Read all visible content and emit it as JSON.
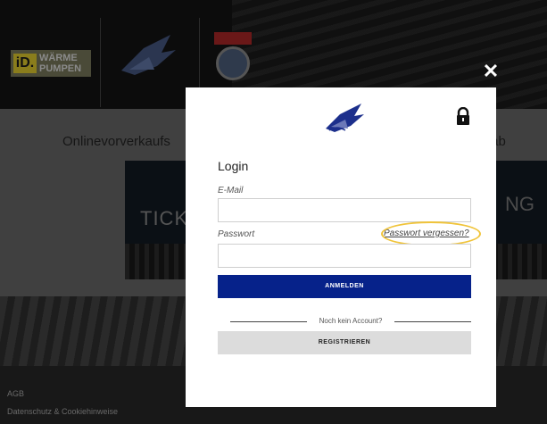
{
  "background": {
    "sponsor_logo": {
      "badge": "iD.",
      "line1": "WÄRME",
      "line2": "PUMPEN"
    },
    "heading_left": "Onlinevorverkaufs",
    "heading_right": "nts ab",
    "banner_left": "TICK",
    "banner_right": "NG",
    "footer": {
      "agb": "AGB",
      "privacy": "Datenschutz & Cookiehinweise"
    }
  },
  "overlay": {
    "close_icon": "close-icon"
  },
  "login": {
    "title": "Login",
    "email_label": "E-Mail",
    "email_value": "",
    "password_label": "Passwort",
    "password_value": "",
    "forgot_link": "Passwort vergessen?",
    "login_button": "ANMELDEN",
    "divider_text": "Noch kein Account?",
    "register_button": "REGISTRIEREN",
    "lock_icon": "lock-icon",
    "logo_icon": "vsv-eagle-logo"
  },
  "colors": {
    "primary_button": "#06228a",
    "highlight": "#f0c43a",
    "secondary_button": "#dcdcdc"
  }
}
